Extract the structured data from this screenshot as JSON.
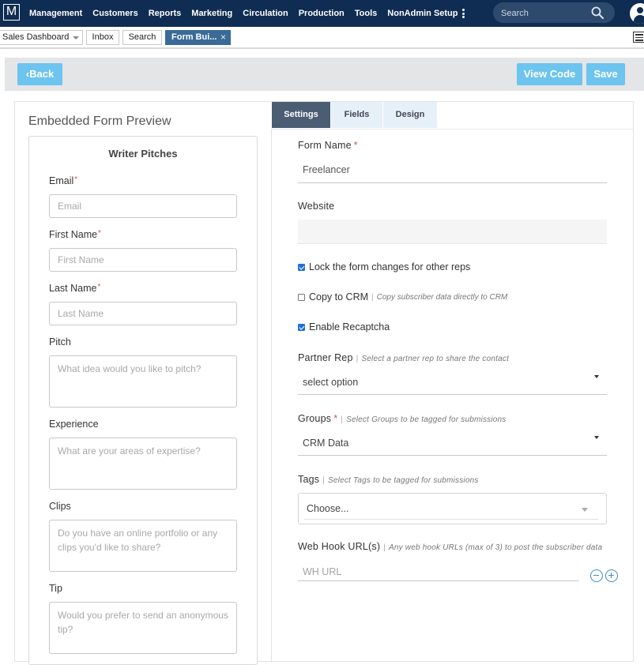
{
  "app": {
    "logo_letter": "M",
    "nav": [
      "Management",
      "Customers",
      "Reports",
      "Marketing",
      "Circulation",
      "Production",
      "Tools",
      "NonAdmin Setup"
    ],
    "search_placeholder": "Search",
    "accent_color": "#6cc4ef",
    "nav_color": "#0f2d52"
  },
  "tabs": {
    "sales": "Sales Dashboard",
    "inbox": "Inbox",
    "search": "Search",
    "form_builder": "Form Bui...",
    "close_glyph": "×"
  },
  "actions": {
    "back": "Back",
    "back_glyph": "‹",
    "view_code": "View Code",
    "save": "Save"
  },
  "preview": {
    "heading": "Embedded Form Preview",
    "form_title": "Writer Pitches",
    "email_label": "Email",
    "email_placeholder": "Email",
    "first_name_label": "First Name",
    "first_name_placeholder": "First Name",
    "last_name_label": "Last Name",
    "last_name_placeholder": "Last Name",
    "pitch_label": "Pitch",
    "pitch_placeholder": "What idea would you like to pitch?",
    "experience_label": "Experience",
    "experience_placeholder": "What are your areas of expertise?",
    "clips_label": "Clips",
    "clips_placeholder": "Do you have an online portfolio or any clips you'd like to share?",
    "tip_label": "Tip",
    "tip_placeholder": "Would you prefer to send an anonymous tip?",
    "required_mark": "*"
  },
  "settings": {
    "tab_settings": "Settings",
    "tab_fields": "Fields",
    "tab_design": "Design",
    "form_name_label": "Form Name",
    "form_name_value": "Freelancer",
    "website_label": "Website",
    "website_value": "",
    "lock_label": "Lock the form changes for other reps",
    "lock_checked": true,
    "copy_crm_label": "Copy to CRM",
    "copy_crm_hint": "Copy subscriber data directly to CRM",
    "copy_crm_checked": false,
    "recaptcha_label": "Enable Recaptcha",
    "recaptcha_checked": true,
    "partner_rep_label": "Partner Rep",
    "partner_rep_hint": "Select a partner rep to share the contact",
    "partner_rep_value": "select option",
    "groups_label": "Groups",
    "groups_hint": "Select Groups to be tagged for submissions",
    "groups_value": "CRM Data",
    "tags_label": "Tags",
    "tags_hint": "Select Tags to be tagged for submissions",
    "tags_value": "Choose...",
    "webhook_label": "Web Hook URL(s)",
    "webhook_hint": "Any web hook URLs (max of 3) to post the subscriber data",
    "webhook_placeholder": "WH URL",
    "required_mark": "*"
  }
}
